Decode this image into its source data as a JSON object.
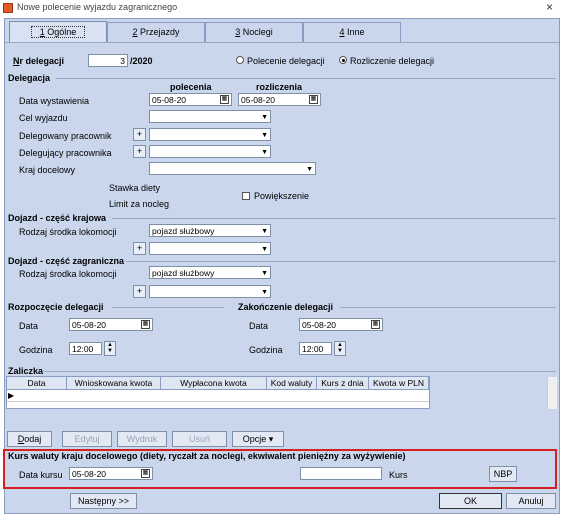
{
  "window": {
    "title": "Nowe polecenie wyjazdu zagranicznego",
    "close": "×"
  },
  "tabs": [
    {
      "num": "1",
      "label": "Ogólne"
    },
    {
      "num": "2",
      "label": "Przejazdy"
    },
    {
      "num": "3",
      "label": "Noclegi"
    },
    {
      "num": "4",
      "label": "Inne"
    }
  ],
  "header": {
    "nr_label": "Nr delegacji",
    "nr_value": "3",
    "nr_suffix": "/2020",
    "radio1": "Polecenie delegacji",
    "radio2": "Rozliczenie delegacji"
  },
  "delegacja": {
    "section": "Delegacja",
    "col_polecenia": "polecenia",
    "col_rozliczenia": "rozliczenia",
    "data_wystawienia": "Data wystawienia",
    "date_polecenia": "05-08-20",
    "date_rozliczenia": "05-08-20",
    "cel_wyjazdu": "Cel wyjazdu",
    "delegowany": "Delegowany pracownik",
    "delegujacy": "Delegujący pracownika",
    "kraj": "Kraj docelowy",
    "stawka": "Stawka diety",
    "limit": "Limit za nocleg",
    "powiekszenie": "Powiększenie"
  },
  "dojazd_krajowa": {
    "section": "Dojazd - część krajowa",
    "rodzaj": "Rodzaj środka lokomocji",
    "value": "pojazd służbowy"
  },
  "dojazd_zagraniczna": {
    "section": "Dojazd - część zagraniczna",
    "rodzaj": "Rodzaj środka lokomocji",
    "value": "pojazd służbowy"
  },
  "rozpoczecie": {
    "section": "Rozpoczęcie delegacji",
    "data_label": "Data",
    "data": "05-08-20",
    "godzina_label": "Godzina",
    "godzina": "12:00"
  },
  "zakonczenie": {
    "section": "Zakończenie delegacji",
    "data_label": "Data",
    "data": "05-08-20",
    "godzina_label": "Godzina",
    "godzina": "12:00"
  },
  "zaliczka": {
    "section": "Zaliczka",
    "columns": [
      "Data",
      "Wnioskowana kwota",
      "Wypłacona kwota",
      "Kod waluty",
      "Kurs z dnia",
      "Kwota w PLN"
    ]
  },
  "buttons": {
    "dodaj": "Dodaj",
    "edytuj": "Edytuj",
    "wydruk": "Wydruk",
    "usun": "Usuń",
    "opcje": "Opcje ▾"
  },
  "kurs": {
    "title": "Kurs waluty kraju docelowego (diety, ryczałt za noclegi, ekwiwalent pieniężny za wyżywienie)",
    "data_kursu": "Data kursu",
    "data_value": "05-08-20",
    "kurs_label": "Kurs",
    "kurs_value": "",
    "nbp": "NBP"
  },
  "footer": {
    "nastepny": "Następny >>",
    "ok": "OK",
    "anuluj": "Anuluj"
  }
}
